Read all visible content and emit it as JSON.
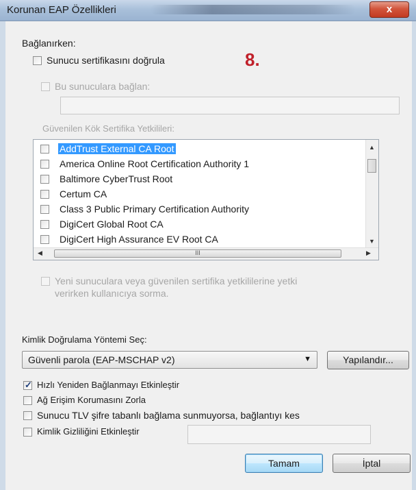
{
  "window": {
    "title": "Korunan EAP Özellikleri",
    "close_label": "x"
  },
  "annotation_marker": "8.",
  "connecting": {
    "heading": "Bağlanırken:",
    "validate_cert_label": "Sunucu sertifikasını doğrula",
    "validate_cert_checked": false,
    "connect_servers_label": "Bu sunuculara bağlan:",
    "connect_servers_checked": false,
    "servers_value": "",
    "trusted_root_heading": "Güvenilen Kök Sertifika Yetkilileri:",
    "cert_list": [
      {
        "label": "AddTrust External CA Root",
        "checked": false,
        "selected": true
      },
      {
        "label": "America Online Root Certification Authority 1",
        "checked": false,
        "selected": false
      },
      {
        "label": "Baltimore CyberTrust Root",
        "checked": false,
        "selected": false
      },
      {
        "label": "Certum CA",
        "checked": false,
        "selected": false
      },
      {
        "label": "Class 3 Public Primary Certification Authority",
        "checked": false,
        "selected": false
      },
      {
        "label": "DigiCert Global Root CA",
        "checked": false,
        "selected": false
      },
      {
        "label": "DigiCert High Assurance EV Root CA",
        "checked": false,
        "selected": false
      }
    ],
    "hscroll_grip": "III",
    "no_prompt_line1": "Yeni sunuculara veya güvenilen sertifika yetkililerine yetki",
    "no_prompt_line2": "verirken kullanıcıya sorma.",
    "no_prompt_checked": false
  },
  "auth": {
    "heading": "Kimlik Doğrulama Yöntemi Seç:",
    "method_selected": "Güvenli parola (EAP-MSCHAP v2)",
    "configure_label": "Yapılandır...",
    "fast_reconnect_label": "Hızlı Yeniden Bağlanmayı Etkinleştir",
    "fast_reconnect_checked": true,
    "nap_label": "Ağ Erişim Korumasını Zorla",
    "nap_checked": false,
    "tlv_label": "Sunucu TLV şifre tabanlı bağlama sunmuyorsa, bağlantıyı kes",
    "tlv_checked": false,
    "identity_privacy_label": "Kimlik Gizliliğini Etkinleştir",
    "identity_privacy_checked": false,
    "identity_value": ""
  },
  "footer": {
    "ok_label": "Tamam",
    "cancel_label": "İptal"
  },
  "icons": {
    "dropdown_arrow": "▼",
    "scroll_up": "▲",
    "scroll_down": "▼",
    "scroll_left": "◀",
    "scroll_right": "▶"
  }
}
